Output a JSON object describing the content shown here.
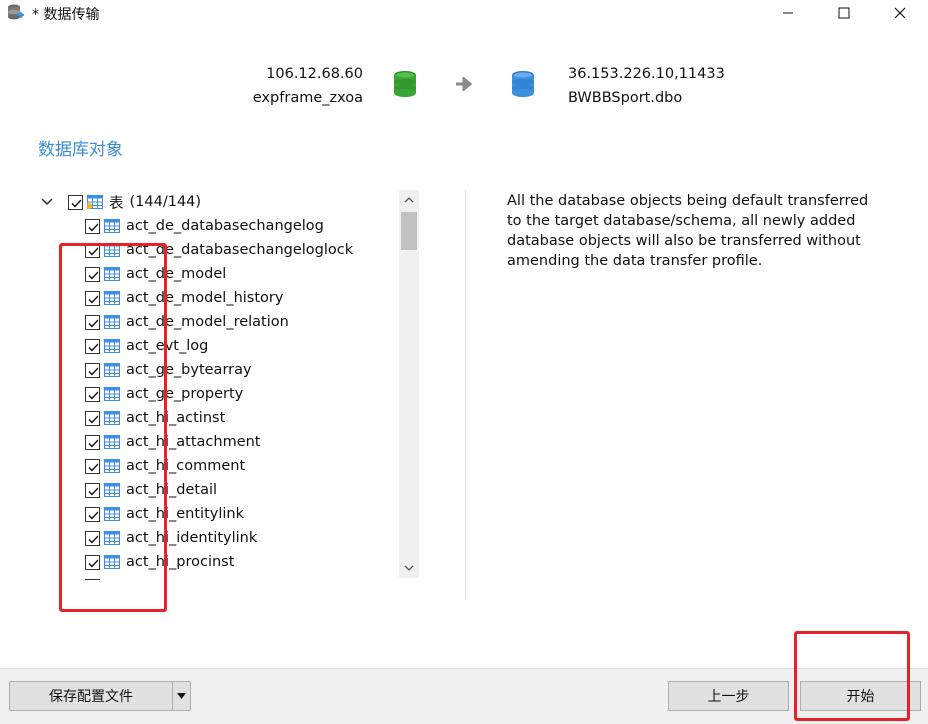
{
  "window": {
    "title": "* 数据传输",
    "icons": {
      "app": "database-stack-icon",
      "minimize": "minimize-icon",
      "maximize": "maximize-icon",
      "close": "close-icon"
    }
  },
  "connection": {
    "source_host": "106.12.68.60",
    "source_db": "expframe_zxoa",
    "target_host": "36.153.226.10,11433",
    "target_db": "BWBBSport.dbo",
    "colors": {
      "source": "#3aa635",
      "target": "#3d8fe0",
      "arrow": "#8a8a8a"
    }
  },
  "section_title": "数据库对象",
  "tree": {
    "root": {
      "label": "表",
      "count": "(144/144)",
      "checked": true
    },
    "items": [
      "act_de_databasechangelog",
      "act_de_databasechangeloglock",
      "act_de_model",
      "act_de_model_history",
      "act_de_model_relation",
      "act_evt_log",
      "act_ge_bytearray",
      "act_ge_property",
      "act_hi_actinst",
      "act_hi_attachment",
      "act_hi_comment",
      "act_hi_detail",
      "act_hi_entitylink",
      "act_hi_identitylink",
      "act_hi_procinst"
    ]
  },
  "description": "All the database objects being default transferred to the target database/schema, all newly added database objects will also be transferred without amending the data transfer profile.",
  "footer": {
    "save_profile": "保存配置文件",
    "prev": "上一步",
    "start": "开始"
  },
  "colors": {
    "annotation": "#e5212b",
    "section_title": "#3a8fd6"
  }
}
